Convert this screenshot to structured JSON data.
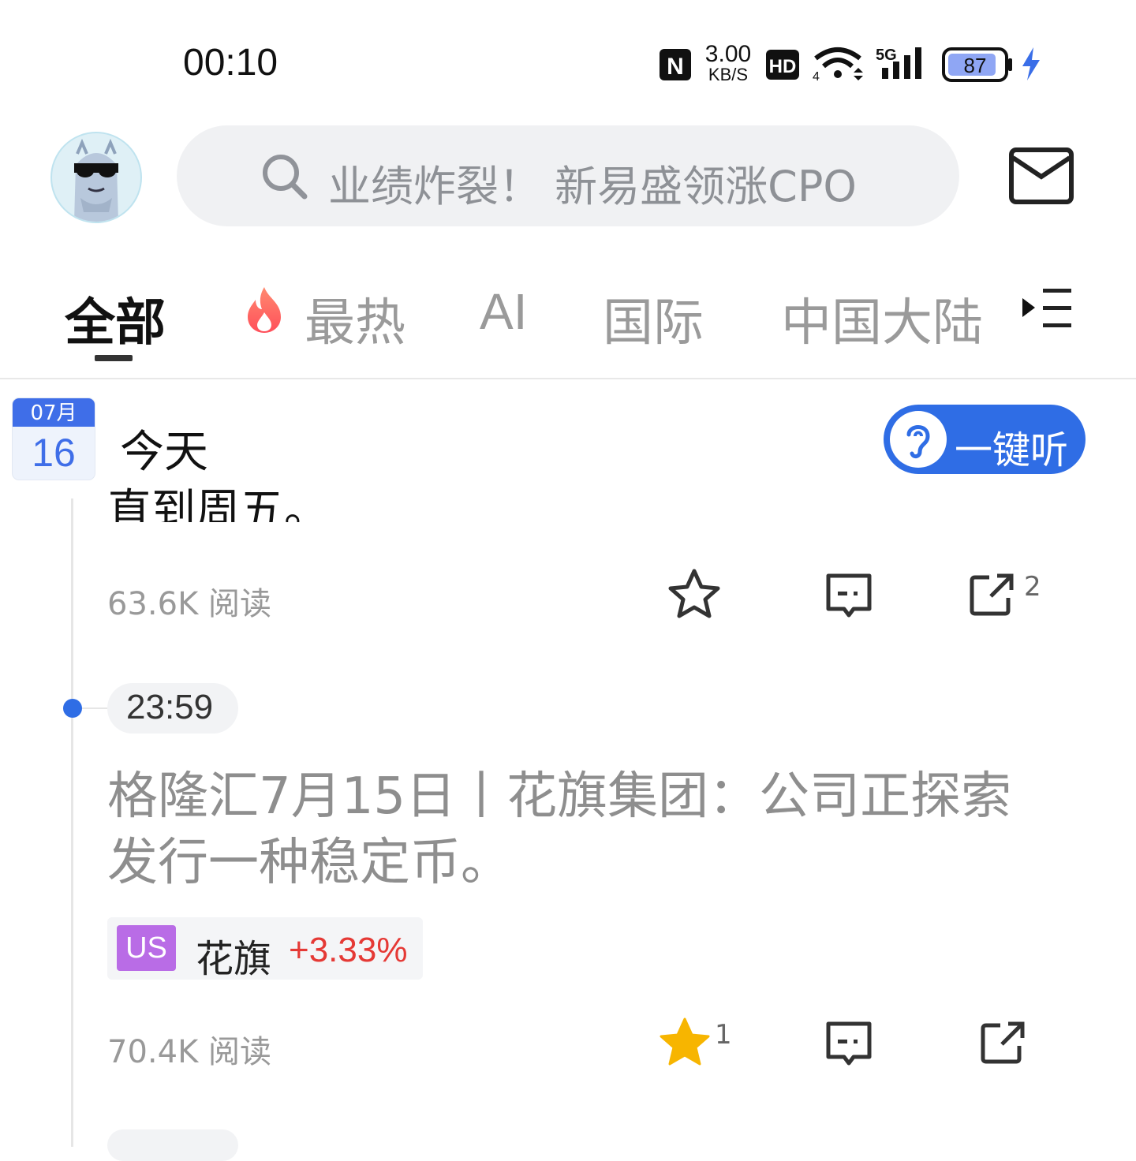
{
  "status_bar": {
    "time": "00:10",
    "nfc_label": "N",
    "net_speed_value": "3.00",
    "net_speed_unit": "KB/S",
    "hd_label": "HD",
    "wifi_sub": "4",
    "cell_label": "5G",
    "battery_level": "87"
  },
  "header": {
    "search_placeholder": "业绩炸裂！ 新易盛领涨CPO"
  },
  "tabs": [
    {
      "label": "全部",
      "selected": true
    },
    {
      "label": "最热",
      "icon": "fire-icon"
    },
    {
      "label": "AI"
    },
    {
      "label": "国际"
    },
    {
      "label": "中国大陆"
    }
  ],
  "date": {
    "month": "07月",
    "day": "16",
    "label": "今天"
  },
  "listen_button": {
    "label": "一键听"
  },
  "feed": [
    {
      "partial_text": "直到周五。",
      "reads": "63.6K",
      "reads_label": "阅读",
      "favorite_count": "",
      "share_count": "2"
    },
    {
      "time": "23:59",
      "headline": "格隆汇7月15日丨花旗集团：公司正探索发行一种稳定币。",
      "stock": {
        "market": "US",
        "name": "花旗",
        "change": "+3.33%"
      },
      "reads": "70.4K",
      "reads_label": "阅读",
      "favorite_count": "1",
      "favorited": true
    }
  ],
  "colors": {
    "accent": "#2f6de5",
    "up": "#e53935",
    "us_badge": "#b96ce6",
    "star_active": "#f7b500"
  }
}
